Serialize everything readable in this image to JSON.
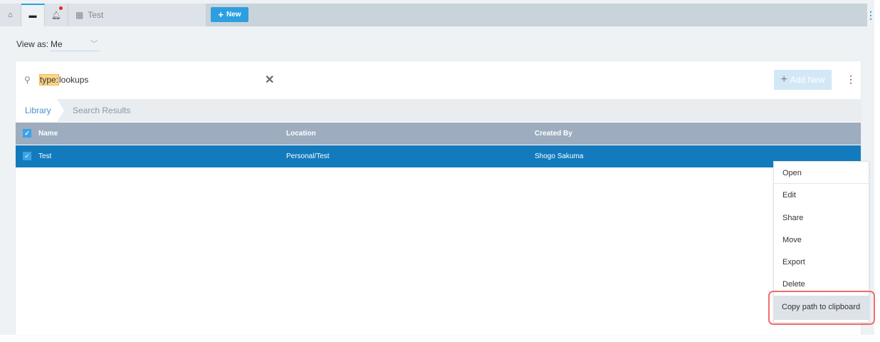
{
  "tabs": {
    "test_label": "Test",
    "new_label": "New"
  },
  "view_as": {
    "label": "View as:",
    "value": "Me"
  },
  "search": {
    "prefix": "type:",
    "query": "lookups",
    "add_new": "Add New"
  },
  "breadcrumb": [
    "Library",
    "Search Results"
  ],
  "table": {
    "columns": [
      "Name",
      "Location",
      "Created By"
    ],
    "rows": [
      {
        "name": "Test",
        "location": "Personal/Test",
        "created_by": "Shogo Sakuma",
        "selected": true
      }
    ]
  },
  "context_menu": [
    "Open",
    "Edit",
    "Share",
    "Move",
    "Export",
    "Delete",
    "Copy path to clipboard"
  ],
  "colors": {
    "accent": "#2d9fe0",
    "selected_row": "#127abd",
    "header": "#9dadbf",
    "highlight_outline": "#f26d6d"
  }
}
